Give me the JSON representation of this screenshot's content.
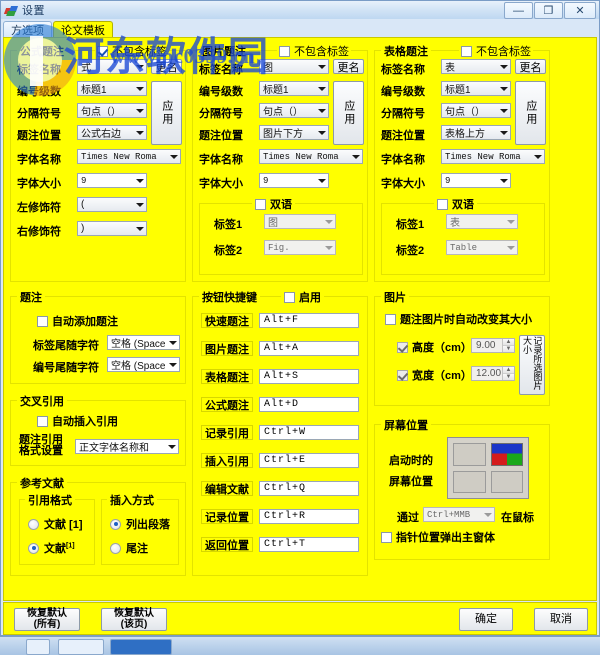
{
  "window": {
    "title": "设置",
    "icon": "app-icon",
    "buttons": {
      "minimize": "—",
      "maximize": "❐",
      "close": "✕"
    }
  },
  "tabs": [
    {
      "label": "方选项",
      "active": false
    },
    {
      "label": "论文模板",
      "active": true
    }
  ],
  "watermark": {
    "text": "河东软件园",
    "url": "www.pc0359.cn"
  },
  "formula_caption": {
    "title": "公式题注",
    "no_label_checkbox": {
      "label": "不包含标签",
      "checked": true
    },
    "rename_button": "更名",
    "apply_button": "应用",
    "fields": [
      {
        "label": "标签名称",
        "value": "式"
      },
      {
        "label": "编号级数",
        "value": "标题1"
      },
      {
        "label": "分隔符号",
        "value": "句点（）"
      },
      {
        "label": "题注位置",
        "value": "公式右边"
      },
      {
        "label": "字体名称",
        "value": "Times New Roma"
      },
      {
        "label": "字体大小",
        "value": "9"
      },
      {
        "label": "左修饰符",
        "value": "("
      },
      {
        "label": "右修饰符",
        "value": ")"
      }
    ]
  },
  "image_caption": {
    "title": "图片题注",
    "no_label_checkbox": {
      "label": "不包含标签",
      "checked": false
    },
    "rename_button": "更名",
    "apply_button": "应用",
    "fields": [
      {
        "label": "标签名称",
        "value": "图"
      },
      {
        "label": "编号级数",
        "value": "标题1"
      },
      {
        "label": "分隔符号",
        "value": "句点（）"
      },
      {
        "label": "题注位置",
        "value": "图片下方"
      },
      {
        "label": "字体名称",
        "value": "Times New Roma"
      },
      {
        "label": "字体大小",
        "value": "9"
      }
    ],
    "bilingual": {
      "title": "双语",
      "checked": false,
      "fields": [
        {
          "label": "标签1",
          "value": "图"
        },
        {
          "label": "标签2",
          "value": "Fig."
        }
      ]
    }
  },
  "table_caption": {
    "title": "表格题注",
    "no_label_checkbox": {
      "label": "不包含标签",
      "checked": false
    },
    "rename_button": "更名",
    "apply_button": "应用",
    "fields": [
      {
        "label": "标签名称",
        "value": "表"
      },
      {
        "label": "编号级数",
        "value": "标题1"
      },
      {
        "label": "分隔符号",
        "value": "句点（）"
      },
      {
        "label": "题注位置",
        "value": "表格上方"
      },
      {
        "label": "字体名称",
        "value": "Times New Roma"
      },
      {
        "label": "字体大小",
        "value": "9"
      }
    ],
    "bilingual": {
      "title": "双语",
      "checked": false,
      "fields": [
        {
          "label": "标签1",
          "value": "表"
        },
        {
          "label": "标签2",
          "value": "Table"
        }
      ]
    }
  },
  "caption_group": {
    "title": "题注",
    "auto_add": {
      "label": "自动添加题注",
      "checked": false
    },
    "fields": [
      {
        "label": "标签尾随字符",
        "value": "空格 (Space"
      },
      {
        "label": "编号尾随字符",
        "value": "空格 (Space"
      }
    ]
  },
  "cross_reference": {
    "title": "交叉引用",
    "auto_insert": {
      "label": "自动插入引用",
      "checked": false
    },
    "format_label": "题注引用\n格式设置",
    "format_label_line1": "题注引用",
    "format_label_line2": "格式设置",
    "format_value": "正文字体名称和"
  },
  "references": {
    "title": "参考文献",
    "citation_format": {
      "title": "引用格式",
      "options": [
        {
          "label": "文献 [1]",
          "selected": false
        },
        {
          "label": "文献 [1]",
          "selected": true,
          "superscript": true
        }
      ]
    },
    "insert_method": {
      "title": "插入方式",
      "options": [
        {
          "label": "列出段落",
          "selected": true
        },
        {
          "label": "尾注",
          "selected": false
        }
      ]
    }
  },
  "shortcuts": {
    "title": "按钮快捷键",
    "enable_checkbox": {
      "label": "启用",
      "checked": false
    },
    "items": [
      {
        "label": "快速题注",
        "key": "Alt+F"
      },
      {
        "label": "图片题注",
        "key": "Alt+A"
      },
      {
        "label": "表格题注",
        "key": "Alt+S"
      },
      {
        "label": "公式题注",
        "key": "Alt+D"
      },
      {
        "label": "记录引用",
        "key": "Ctrl+W"
      },
      {
        "label": "插入引用",
        "key": "Ctrl+E"
      },
      {
        "label": "编辑文献",
        "key": "Ctrl+Q"
      },
      {
        "label": "记录位置",
        "key": "Ctrl+R"
      },
      {
        "label": "返回位置",
        "key": "Ctrl+T"
      }
    ]
  },
  "picture": {
    "title": "图片",
    "auto_resize": {
      "label": "题注图片时自动改变其大小",
      "checked": false
    },
    "height": {
      "label": "高度（cm）",
      "value": "9.00",
      "checked": true
    },
    "width": {
      "label": "宽度（cm）",
      "value": "12.00",
      "checked": true
    },
    "record_button": "记录所选图片大小"
  },
  "screen_position": {
    "title": "屏幕位置",
    "label_line1": "启动时的",
    "label_line2": "屏幕位置",
    "selected_cell": "top-right",
    "popup": {
      "via_label": "通过",
      "key_value": "Ctrl+MMB",
      "at_mouse_label": "在鼠标",
      "desc_label": "指针位置弹出主窗体",
      "checked": false
    }
  },
  "bottom_bar": {
    "restore_all": {
      "line1": "恢复默认",
      "line2": "(所有)"
    },
    "restore_page": {
      "line1": "恢复默认",
      "line2": "(该页)"
    },
    "ok": "确定",
    "cancel": "取消"
  }
}
